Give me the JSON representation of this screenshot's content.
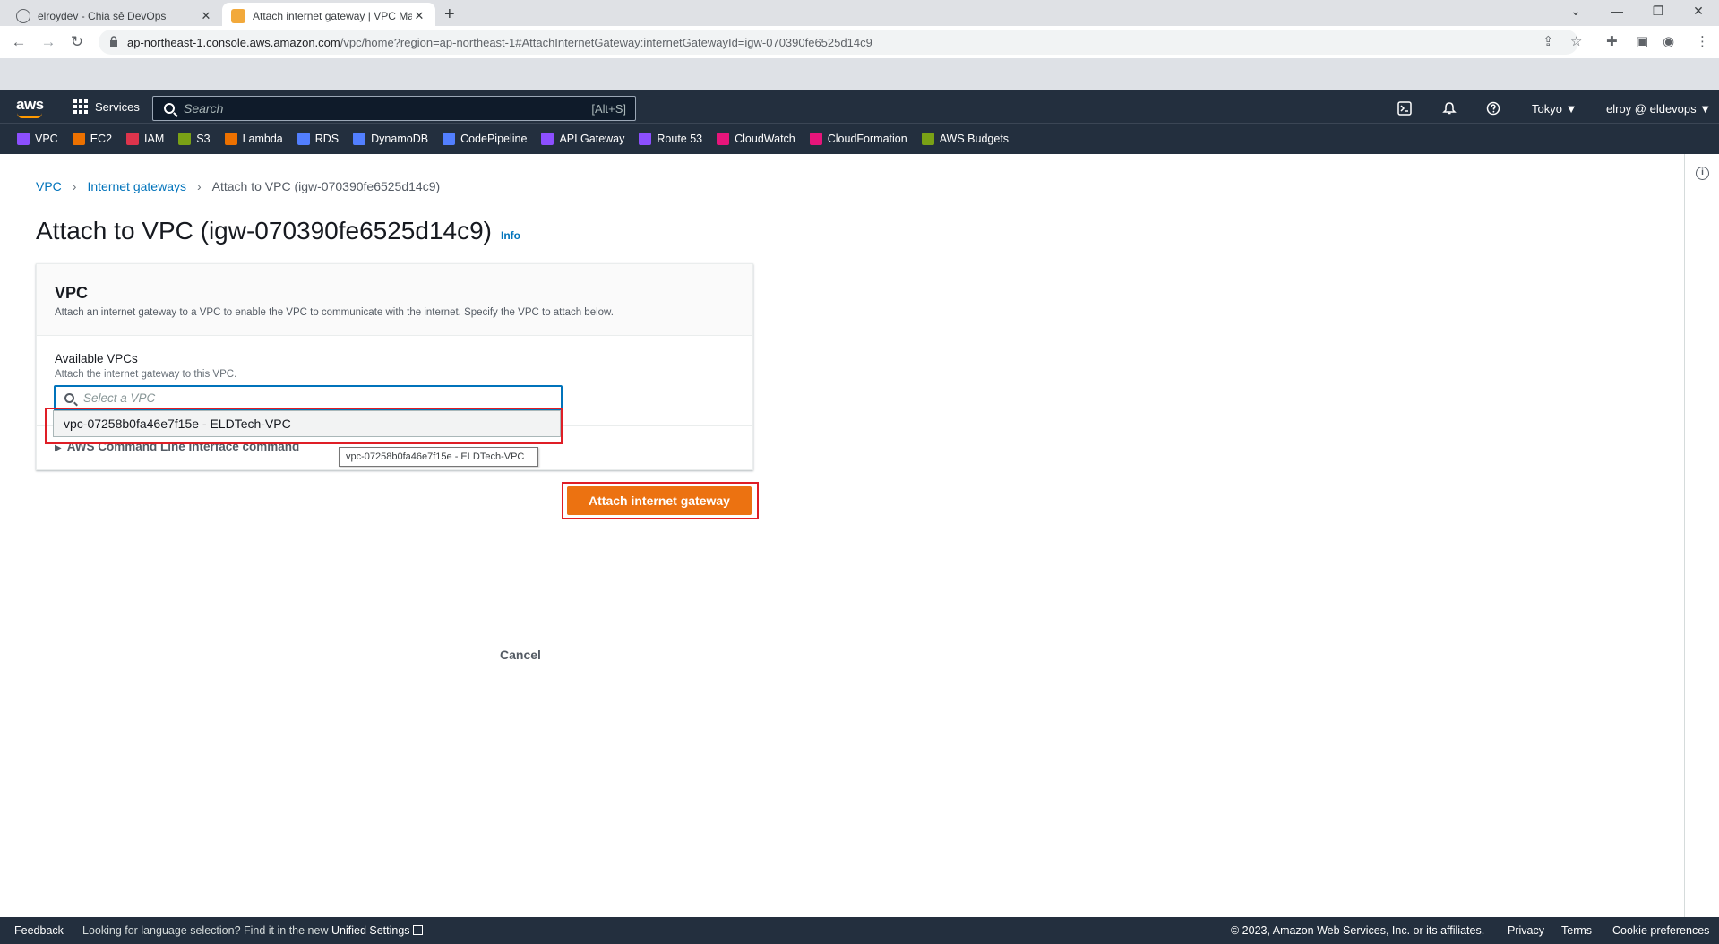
{
  "browser": {
    "tabs": [
      {
        "title": "elroydev - Chia sẻ DevOps",
        "active": false
      },
      {
        "title": "Attach internet gateway | VPC Ma",
        "active": true
      }
    ],
    "url_host": "ap-northeast-1.console.aws.amazon.com",
    "url_path": "/vpc/home?region=ap-northeast-1#AttachInternetGateway:internetGatewayId=igw-070390fe6525d14c9"
  },
  "aws_header": {
    "logo": "aws",
    "services_label": "Services",
    "search_placeholder": "Search",
    "search_shortcut": "[Alt+S]",
    "region": "Tokyo ▼",
    "user": "elroy @ eldevops ▼"
  },
  "favorites": [
    {
      "label": "VPC",
      "color": "#8c4fff"
    },
    {
      "label": "EC2",
      "color": "#ed7100"
    },
    {
      "label": "IAM",
      "color": "#dd344c"
    },
    {
      "label": "S3",
      "color": "#7aa116"
    },
    {
      "label": "Lambda",
      "color": "#ed7100"
    },
    {
      "label": "RDS",
      "color": "#527fff"
    },
    {
      "label": "DynamoDB",
      "color": "#527fff"
    },
    {
      "label": "CodePipeline",
      "color": "#527fff"
    },
    {
      "label": "API Gateway",
      "color": "#8c4fff"
    },
    {
      "label": "Route 53",
      "color": "#8c4fff"
    },
    {
      "label": "CloudWatch",
      "color": "#e7157b"
    },
    {
      "label": "CloudFormation",
      "color": "#e7157b"
    },
    {
      "label": "AWS Budgets",
      "color": "#7aa116"
    }
  ],
  "breadcrumb": {
    "vpc": "VPC",
    "igw": "Internet gateways",
    "current": "Attach to VPC (igw-070390fe6525d14c9)"
  },
  "page": {
    "title": "Attach to VPC (igw-070390fe6525d14c9)",
    "info": "Info"
  },
  "panel": {
    "heading": "VPC",
    "description": "Attach an internet gateway to a VPC to enable the VPC to communicate with the internet. Specify the VPC to attach below.",
    "field_label": "Available VPCs",
    "field_desc": "Attach the internet gateway to this VPC.",
    "select_placeholder": "Select a VPC",
    "option": "vpc-07258b0fa46e7f15e - ELDTech-VPC",
    "cli_label": "AWS Command Line Interface command",
    "tooltip": "vpc-07258b0fa46e7f15e - ELDTech-VPC"
  },
  "actions": {
    "cancel": "Cancel",
    "attach": "Attach internet gateway"
  },
  "footer": {
    "feedback": "Feedback",
    "lang_prefix": "Looking for language selection? Find it in the new",
    "lang_link": "Unified Settings",
    "copyright": "© 2023, Amazon Web Services, Inc. or its affiliates.",
    "privacy": "Privacy",
    "terms": "Terms",
    "cookie": "Cookie preferences"
  },
  "colors": {
    "aws_nav": "#232f3e",
    "primary_button": "#ec7211",
    "link": "#0073bb",
    "highlight_box": "#df1e26"
  }
}
